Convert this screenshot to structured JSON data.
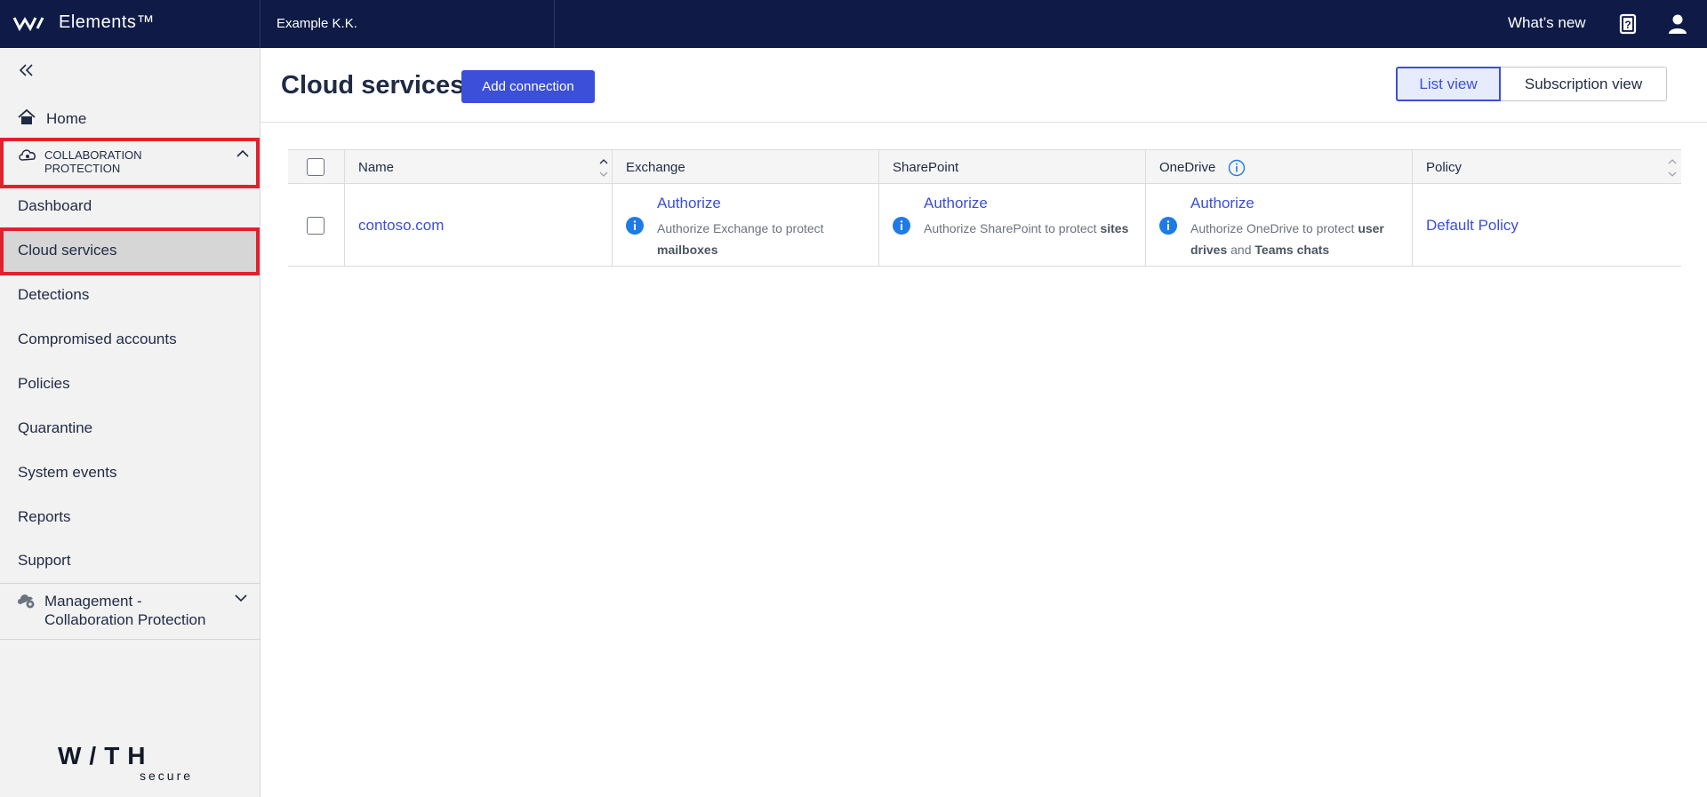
{
  "app": {
    "brand": "Elements™",
    "org": "Example K.K."
  },
  "topbar": {
    "whats_new": "What’s new",
    "help_icon": "help-icon",
    "user_icon": "user-icon"
  },
  "sidebar": {
    "home": "Home",
    "group_label": "COLLABORATION PROTECTION",
    "items": [
      {
        "label": "Dashboard"
      },
      {
        "label": "Cloud services",
        "active": true
      },
      {
        "label": "Detections"
      },
      {
        "label": "Compromised accounts"
      },
      {
        "label": "Policies"
      },
      {
        "label": "Quarantine"
      },
      {
        "label": "System events"
      },
      {
        "label": "Reports"
      },
      {
        "label": "Support"
      }
    ],
    "management": "Management - Collaboration Protection",
    "logo_main": "W/TH",
    "logo_sub": "secure"
  },
  "page": {
    "title": "Cloud services",
    "add_connection": "Add connection",
    "list_view": "List view",
    "subscription_view": "Subscription view"
  },
  "table": {
    "columns": [
      "Name",
      "Exchange",
      "SharePoint",
      "OneDrive",
      "Policy"
    ],
    "rows": [
      {
        "name": "contoso.com",
        "exchange": {
          "link": "Authorize",
          "desc_pre": "Authorize Exchange to protect ",
          "desc_bold": "mailboxes"
        },
        "sharepoint": {
          "link": "Authorize",
          "desc_pre": "Authorize SharePoint to protect ",
          "desc_bold": "sites"
        },
        "onedrive": {
          "link": "Authorize",
          "desc_pre": "Authorize OneDrive to protect ",
          "desc_bold1": "user drives",
          "desc_mid": " and ",
          "desc_bold2": "Teams chats"
        },
        "policy": "Default Policy"
      }
    ]
  },
  "colors": {
    "topbar": "#0f1b46",
    "accent": "#3b4fd8",
    "highlight": "#e3202d",
    "info": "#1e7be6"
  }
}
